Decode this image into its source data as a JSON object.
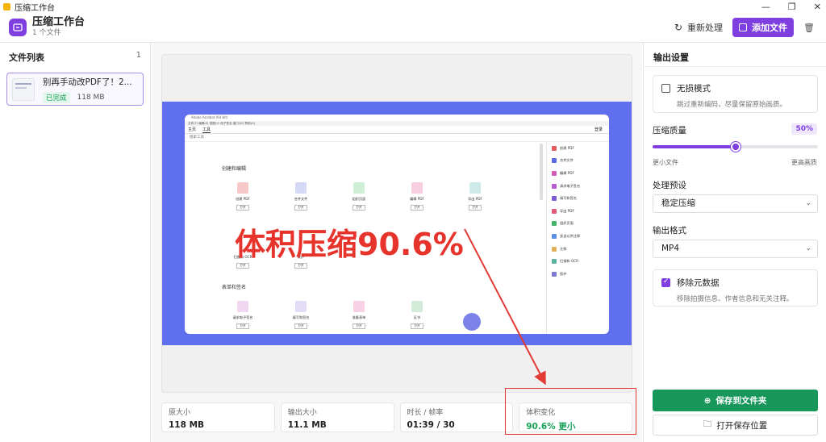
{
  "window": {
    "title": "压缩工作台",
    "controls": [
      "—",
      "❐",
      "✕"
    ]
  },
  "header": {
    "title": "压缩工作台",
    "subtitle": "1 个文件",
    "reprocess": "重新处理",
    "add_file": "添加文件"
  },
  "sidebar": {
    "title": "文件列表",
    "count": "1",
    "files": [
      {
        "name": "别再手动改PDF了！2...",
        "status": "已完成",
        "size": "118 MB"
      }
    ]
  },
  "preview": {
    "overlay_text": "体积压缩90.6%",
    "mock": {
      "title": "Adobe Acrobat (64-bit)",
      "menu": "文件(F)  编辑(E)  视图(V)  电子签名  窗口(W)  帮助(H)",
      "tabs": [
        "主页",
        "工具"
      ],
      "search": "搜索工具",
      "section1": "创建和编辑",
      "section2": "表单和签名",
      "tools_row1": [
        "创建 PDF",
        "合并文件",
        "组织页面",
        "编辑 PDF",
        "导出 PDF"
      ],
      "tools_row2": [
        "扫描和 OCR",
        "保护"
      ],
      "tools_row3": [
        "请求电子签名",
        "填写和签名",
        "准备表单",
        "证书"
      ],
      "open_label": "打开",
      "side_items": [
        "创建 PDF",
        "合并文件",
        "编辑 PDF",
        "请求电子签名",
        "填写和签名",
        "导出 PDF",
        "组织页面",
        "发送以供注释",
        "注释",
        "扫描和 OCR",
        "保护"
      ],
      "login": "登录"
    }
  },
  "stats": [
    {
      "label": "原大小",
      "value": "118 MB"
    },
    {
      "label": "输出大小",
      "value": "11.1 MB"
    },
    {
      "label": "时长 / 帧率",
      "value": "01:39 / 30"
    },
    {
      "label": "体积变化",
      "value": "90.6% 更小"
    }
  ],
  "settings": {
    "title": "输出设置",
    "lossless": {
      "label": "无损模式",
      "desc": "跳过重新编码，尽量保留原始画质。",
      "checked": false
    },
    "quality": {
      "label": "压缩质量",
      "value": 50,
      "value_text": "50%",
      "min_label": "更小文件",
      "max_label": "更高画质"
    },
    "preset": {
      "label": "处理预设",
      "value": "稳定压缩"
    },
    "format": {
      "label": "输出格式",
      "value": "MP4"
    },
    "strip_meta": {
      "label": "移除元数据",
      "desc": "移除拍摄信息、作者信息和无关注释。",
      "checked": true
    },
    "save_button": "保存到文件夹",
    "open_button": "打开保存位置"
  },
  "colors": {
    "accent": "#7f3fe0",
    "success": "#18975a",
    "annotation": "#e23b36"
  }
}
